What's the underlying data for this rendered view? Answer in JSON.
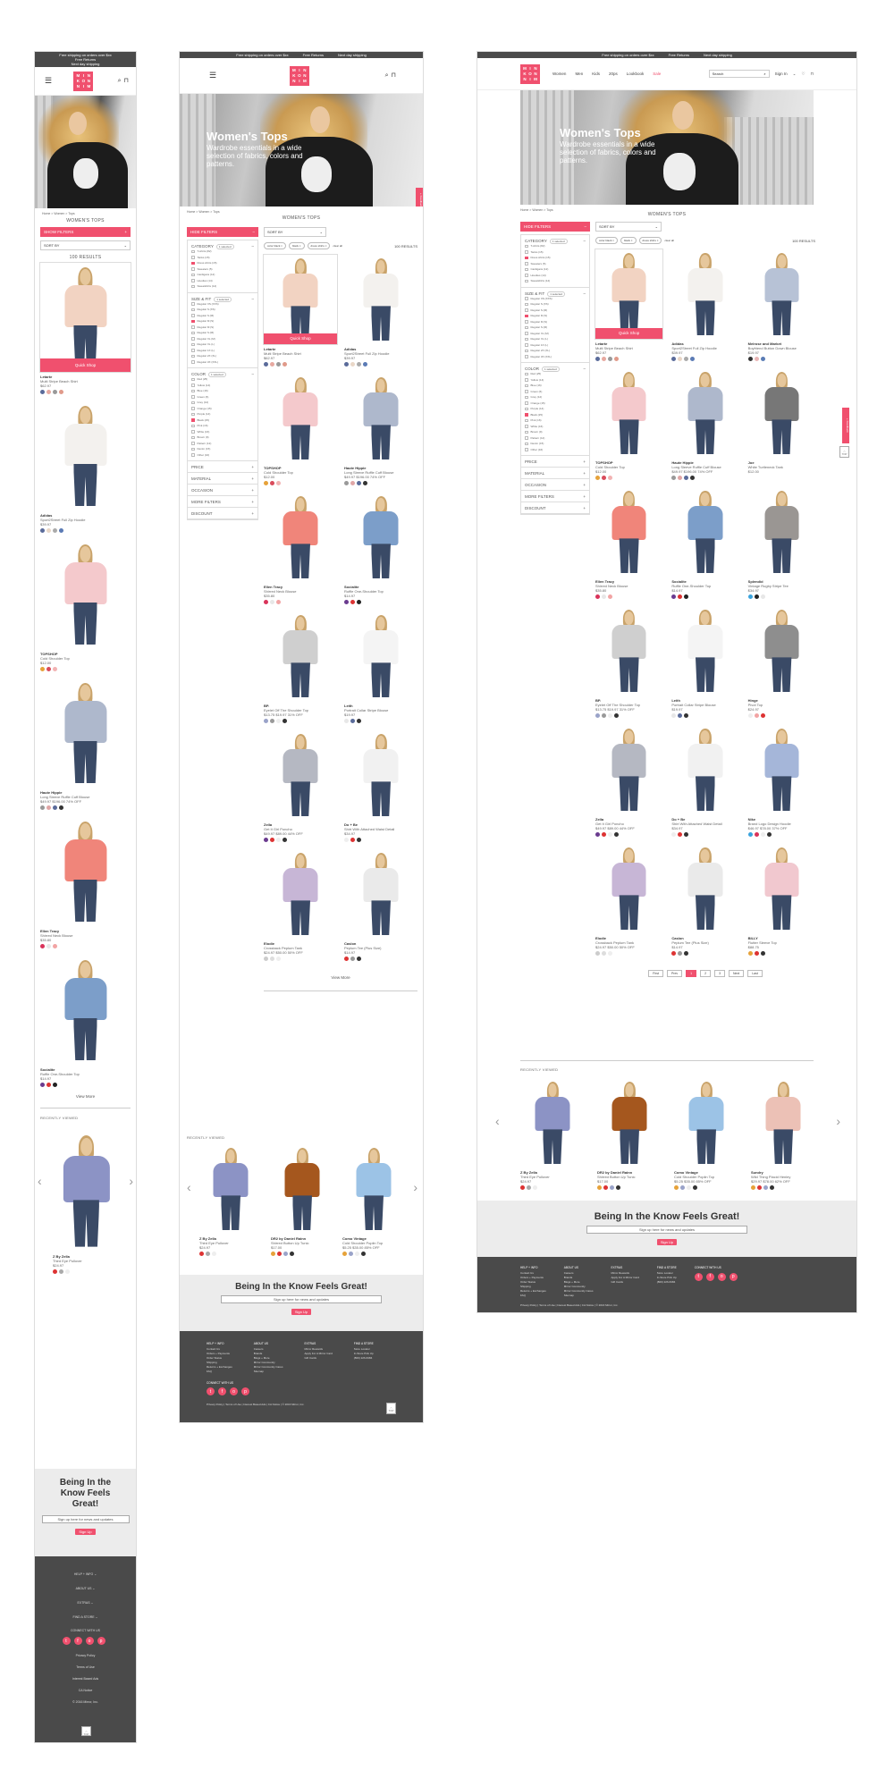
{
  "promo": {
    "free_shipping": "Free shipping on orders over $xx",
    "free_returns": "Free Returns",
    "next_day": "Next day shipping"
  },
  "logo": {
    "letters": [
      "M",
      "I",
      "N",
      "K",
      "O",
      "N",
      "N",
      "I",
      "M"
    ]
  },
  "nav": {
    "items": [
      "Women",
      "Men",
      "Kids",
      "20ps",
      "Lookbook",
      "Sale"
    ],
    "search_placeholder": "Search",
    "sign_in": "Sign In"
  },
  "hero": {
    "title": "Women's Tops",
    "subtitle": "Wardrobe essentials in a wide selection of fabrics, colors and patterns."
  },
  "breadcrumb": "Home > Women > Tops",
  "page_title": "WOMEN'S TOPS",
  "filters": {
    "show_label": "SHOW FILTERS",
    "hide_label": "HIDE FILTERS",
    "sort_label": "SORT BY",
    "results": "100 RESULTS",
    "chips": [
      "color black",
      "black",
      "dress shirts",
      "clear all"
    ],
    "category": {
      "title": "CATEGORY",
      "badge": "1 selected",
      "options": [
        "T-shirts (82)",
        "Tanks (15)",
        "Dress shirts (15)",
        "Sweaters (5)",
        "Cardigans (12)",
        "Hoodies (14)",
        "Sweatshirts (14)"
      ]
    },
    "size": {
      "title": "SIZE & FIT",
      "badge": "1 selected",
      "options": [
        "Regular XS (XXS)",
        "Regular S (XS)",
        "Regular S (M)",
        "Regular M (S)",
        "Regular M (S)",
        "Regular S (M)",
        "Regular XL (M)",
        "Regular XL (L)",
        "Regular 1X (L)",
        "Regular 2X (XL)",
        "Regular 3X (XXL)"
      ]
    },
    "color": {
      "title": "COLOR",
      "badge": "1 selected",
      "options": [
        "Red (25)",
        "Yellow (14)",
        "Blue (16)",
        "Green (6)",
        "Grey (12)",
        "Orange (15)",
        "Purple (14)",
        "Black (25)",
        "Pink (16)",
        "White (16)",
        "Brown (9)",
        "Pattern (12)",
        "Denim (15)",
        "Other (16)"
      ]
    },
    "more": [
      "PRICE",
      "MATERIAL",
      "OCCASION",
      "MORE FILTERS",
      "DISCOUNT"
    ]
  },
  "products": [
    {
      "brand": "Letarte",
      "name": "Multi Stripe Beach Shirt",
      "price": "$62.97",
      "top": "#f2d3c2",
      "colors": [
        "#5a6b9a",
        "#e7a9a0",
        "#999",
        "#e09a8a"
      ]
    },
    {
      "brand": "Adidas",
      "name": "Sport2Street Full Zip Hoodie",
      "price": "$39.97",
      "top": "#f3f1ee",
      "colors": [
        "#5a6b9a",
        "#e9d7c7",
        "#aaa",
        "#5b7bb5"
      ]
    },
    {
      "brand": "Melrose and Market",
      "name": "Boyfriend Button Down Blouse",
      "price": "$19.97",
      "top": "#b7c2d6",
      "colors": [
        "#333",
        "#e9b6b6",
        "#5a7cb5"
      ]
    },
    {
      "brand": "TOPSHOP",
      "name": "Cold Shoulder Top",
      "price": "$12.00",
      "top": "#f4c9cc",
      "colors": [
        "#e6a23a",
        "#d94b5b",
        "#f2b3b3"
      ]
    },
    {
      "brand": "Haute Hippie",
      "name": "Long Sleeve Ruffle Cuff Blouse",
      "price": "$49.97 $196.00 74% OFF",
      "top": "#aeb8cc",
      "colors": [
        "#999",
        "#e0a6a6",
        "#5a6b9a",
        "#333"
      ]
    },
    {
      "brand": "Joe",
      "name": "White Turtleneck Tank",
      "price": "$12.00",
      "top": "#777",
      "colors": []
    },
    {
      "brand": "Ellen Tracy",
      "name": "Shirred Neck Blouse",
      "price": "$35.80",
      "top": "#f0857a",
      "colors": [
        "#d9335a",
        "#e7e7e7",
        "#f2a4a4"
      ]
    },
    {
      "brand": "Socialite",
      "name": "Ruffle One-Shoulder Top",
      "price": "$14.97",
      "top": "#7c9ec9",
      "colors": [
        "#6a3b8f",
        "#d33",
        "#222"
      ]
    },
    {
      "brand": "Splendid",
      "name": "Vintage Rugby Stripe Tee",
      "price": "$34.97",
      "top": "#9a9693",
      "colors": [
        "#3aa3dd",
        "#222",
        "#e7e7e7"
      ]
    },
    {
      "brand": "BP.",
      "name": "Eyelet Off The Shoulder Top",
      "price": "$13.75 $19.97 31% OFF",
      "top": "#cfcfcf",
      "colors": [
        "#9aa3c9",
        "#999",
        "#eee",
        "#333"
      ]
    },
    {
      "brand": "Leith",
      "name": "Portrait Collar Stripe Blouse",
      "price": "$19.97",
      "top": "#f4f4f4",
      "colors": [
        "#e7e7e7",
        "#5a6b9a",
        "#333"
      ]
    },
    {
      "brand": "Hinge",
      "name": "Pivot Top",
      "price": "$24.97",
      "top": "#8e8e8e",
      "colors": [
        "#eee",
        "#f2a4a4",
        "#d33"
      ]
    },
    {
      "brand": "Zella",
      "name": "Get It Girl Poncho",
      "price": "$49.97 $89.00 44% OFF",
      "top": "#b5b8c2",
      "colors": [
        "#6a3b8f",
        "#d33",
        "#eee",
        "#333"
      ]
    },
    {
      "brand": "Do + Be",
      "name": "Shirt With Attached Waist Detail",
      "price": "$34.97",
      "top": "#f1f1f1",
      "colors": [
        "#eee",
        "#d33",
        "#333"
      ]
    },
    {
      "brand": "Nike",
      "name": "Brand Logo Design Hoodie",
      "price": "$46.97 $78.00 37% OFF",
      "top": "#a5b6d9",
      "colors": [
        "#3aa3dd",
        "#d9335a",
        "#eee",
        "#333"
      ]
    },
    {
      "brand": "Elodie",
      "name": "Crossback Peplum Tank",
      "price": "$24.97 $50.00 50% OFF",
      "top": "#c7b6d6",
      "colors": [
        "#ccc",
        "#ddd",
        "#eee"
      ]
    },
    {
      "brand": "Caslon",
      "name": "Peplum Tee (Plus Size)",
      "price": "$14.97",
      "top": "#eaeaea",
      "colors": [
        "#d33",
        "#999",
        "#333"
      ]
    },
    {
      "brand": "BILLY",
      "name": "Flutter Sleeve Top",
      "price": "$88.75",
      "top": "#f1c8cf",
      "colors": [
        "#e6a23a",
        "#d33",
        "#333"
      ]
    }
  ],
  "pagination": {
    "first": "First",
    "prev": "Prev",
    "pages": [
      "1",
      "2",
      "3"
    ],
    "next": "Next",
    "last": "Last"
  },
  "view_more": "View More",
  "quick_shop": "Quick Shop",
  "recent": {
    "title": "RECENTLY VIEWED",
    "items": [
      {
        "brand": "Z By Zella",
        "name": "Third Eye Pullover",
        "price": "$24.97",
        "top": "#8c93c5",
        "colors": [
          "#d33",
          "#aaa",
          "#eee"
        ]
      },
      {
        "brand": "DR2 by Daniel Rainn",
        "name": "Shirred Button Up Tunic",
        "price": "$17.00",
        "top": "#a5571e",
        "colors": [
          "#e6a23a",
          "#d33",
          "#9aa3c9",
          "#333"
        ]
      },
      {
        "brand": "Como Vintage",
        "name": "Cold Shoulder Poplin Top",
        "price": "$5.25 $35.00 85% OFF",
        "top": "#9cc3e6",
        "colors": [
          "#e6a23a",
          "#9aa3c9",
          "#eee",
          "#333"
        ]
      },
      {
        "brand": "Sundry",
        "name": "Wild Thing Placid Henley",
        "price": "$29.97 $78.00 62% OFF",
        "top": "#ecc1b6",
        "colors": [
          "#e6a23a",
          "#d33",
          "#9aa3c9",
          "#333"
        ]
      }
    ]
  },
  "newsletter": {
    "title": "Being In the Know Feels Great!",
    "placeholder": "Sign up here for news and updates",
    "button": "Sign Up"
  },
  "footer": {
    "cols": [
      {
        "title": "HELP + INFO",
        "links": [
          "Contact Us",
          "Orders + Payments",
          "Order Status",
          "Shipping",
          "Returns + Exchanges",
          "FAQ"
        ]
      },
      {
        "title": "ABOUT US",
        "links": [
          "Careers",
          "Brands",
          "Blogs + More",
          "Mirror Community",
          "Mirror Community Cares",
          "Sitemap"
        ]
      },
      {
        "title": "EXTRAS",
        "links": [
          "Mirror Rewards",
          "Apply For A Mirror Card",
          "Gift Cards"
        ]
      },
      {
        "title": "FIND A STORE",
        "links": [
          "Store Locator",
          "In-Store Pick Up",
          "(800) 226-6384"
        ]
      }
    ],
    "connect": "CONNECT WITH US",
    "social": [
      "t",
      "f",
      "o",
      "p"
    ],
    "legal": "Privacy Policy | Terms of Use | Interest Based Ads | CA Notice | © 2016 Mirror, Inc.",
    "mobile_links": [
      "Privacy Policy",
      "Terms of Use",
      "Interest Based Ads",
      "CA Notice",
      "© 2016 Mirror, Inc."
    ],
    "top": "TOP",
    "feedback": "+ Feedback"
  },
  "colors": {
    "accent": "#f0506e",
    "dark": "#4a4a4a"
  }
}
